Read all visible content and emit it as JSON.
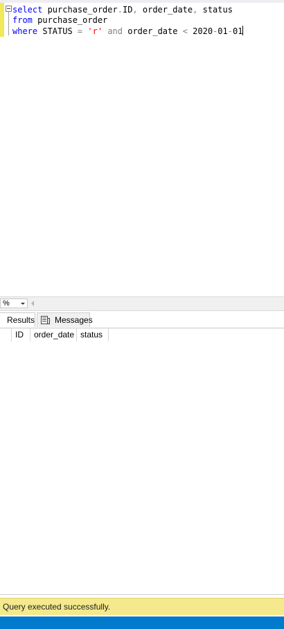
{
  "editor": {
    "lines": [
      {
        "kw1": "select",
        "t1": " purchase_order",
        "op1": ".",
        "t2": "ID",
        "op2": ",",
        "t3": " order_date",
        "op3": ",",
        "t4": " status"
      },
      {
        "kw1": "from",
        "t1": " purchase_order"
      },
      {
        "kw1": "where",
        "t1": " STATUS ",
        "op1": "=",
        "sp1": " ",
        "str1": "'r'",
        "sp2": " ",
        "kw2": "and",
        "t2": " order_date ",
        "op2": "<",
        "t3": " 2020",
        "op3": "-",
        "t4": "01",
        "op4": "-",
        "t5": "01"
      }
    ]
  },
  "zoom": {
    "value": "%"
  },
  "tabs": {
    "results": "Results",
    "messages": "Messages"
  },
  "grid": {
    "columns": [
      "ID",
      "order_date",
      "status"
    ]
  },
  "status": {
    "message": "Query executed successfully."
  },
  "colors": {
    "accent": "#007acc",
    "status_bar": "#f4e98c",
    "keyword": "#0000ff",
    "string": "#ff0000",
    "operator": "#808080"
  }
}
